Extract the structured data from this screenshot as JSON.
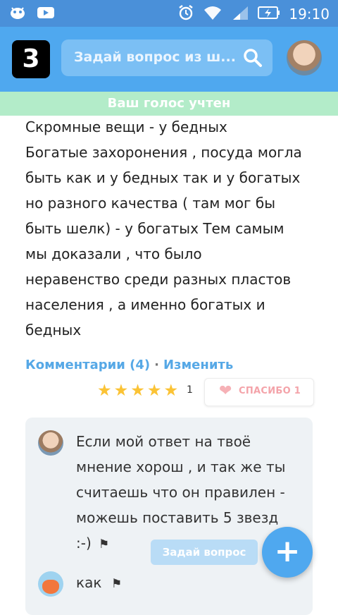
{
  "status_bar": {
    "time": "19:10",
    "icons": [
      "app-icon",
      "youtube-icon",
      "alarm-icon",
      "wifi-icon",
      "signal-icon",
      "battery-charging-icon"
    ]
  },
  "header": {
    "logo_text": "3",
    "search_placeholder": "Задай вопрос из ш...",
    "accent": "#4fa8ef"
  },
  "toast": {
    "text": "Ваш голос учтен"
  },
  "answer": {
    "lines": [
      "Скромные вещи - у бедных",
      "Богатые захоронения , посуда могла",
      "быть как и у бедных так и у богатых",
      "но разного качества ( там мог бы",
      "быть шелк) - у богатых Тем самым",
      "мы доказали , что было",
      "неравенство среди разных пластов",
      "населения , а именно богатых и",
      "бедных"
    ]
  },
  "actions": {
    "comments_link": "Комментарии (4)",
    "separator": "·",
    "edit_link": "Изменить"
  },
  "rating": {
    "stars": 5,
    "count": "1"
  },
  "thanks": {
    "label": "СПАСИБО 1"
  },
  "comments": [
    {
      "lines": [
        "Если мой ответ на твоё",
        "мнение хорош , и так же ты",
        "считаешь что он правилен -",
        "можешь поставить 5 звезд",
        ":-)"
      ]
    },
    {
      "text": "как"
    }
  ],
  "floating": {
    "ask_label": "Задай вопрос",
    "fab_label": "+"
  }
}
